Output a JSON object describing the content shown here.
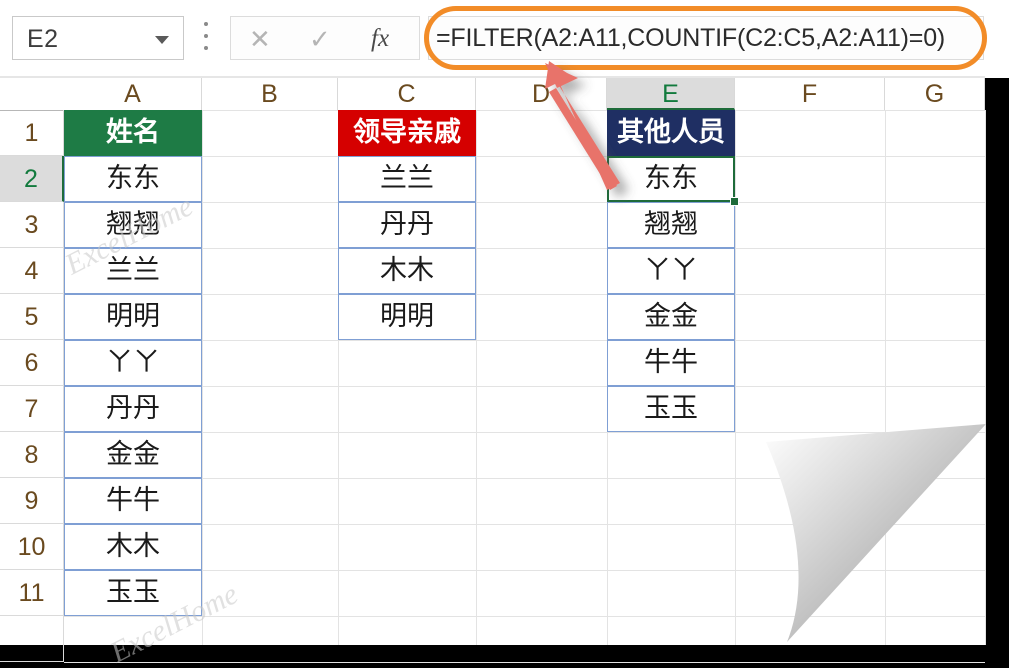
{
  "app": {
    "name_box_value": "E2",
    "formula": "=FILTER(A2:A11,COUNTIF(C2:C5,A2:A11)=0)",
    "cancel_icon": "✕",
    "confirm_icon": "✓",
    "fx_icon": "fx",
    "dropdown_icon": "chevron-down",
    "more_icon": "vertical-dots"
  },
  "grid": {
    "columns": [
      "A",
      "B",
      "C",
      "D",
      "E",
      "F",
      "G"
    ],
    "selected_column": "E",
    "rows": [
      "1",
      "2",
      "3",
      "4",
      "5",
      "6",
      "7",
      "8",
      "9",
      "10",
      "11"
    ],
    "selected_row": "2",
    "selected_cell": "E2"
  },
  "headers": {
    "a1": "姓名",
    "c1": "领导亲戚",
    "e1": "其他人员"
  },
  "colors": {
    "a1_fill": "#1E7B45",
    "c1_fill": "#D50000",
    "e1_fill": "#1F2F63",
    "selection_border": "#1E6B3A",
    "data_border": "#7F9FD4",
    "highlight_oval": "#F28C28",
    "arrow": "#E8736B"
  },
  "data": {
    "column_a": [
      "东东",
      "翘翘",
      "兰兰",
      "明明",
      "ㄚㄚ",
      "丹丹",
      "金金",
      "牛牛",
      "木木",
      "玉玉"
    ],
    "column_c": [
      "兰兰",
      "丹丹",
      "木木",
      "明明"
    ],
    "column_e": [
      "东东",
      "翘翘",
      "ㄚㄚ",
      "金金",
      "牛牛",
      "玉玉"
    ]
  },
  "watermarks": [
    "ExcelHome",
    "ExcelHome"
  ]
}
